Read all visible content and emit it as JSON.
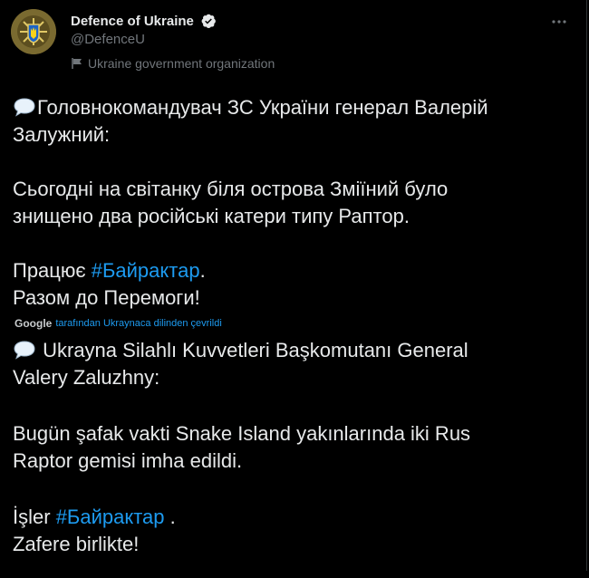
{
  "account": {
    "display_name": "Defence of Ukraine",
    "handle": "@DefenceU",
    "org_label": "Ukraine government organization"
  },
  "icons": {
    "verified": "verified-badge-icon",
    "more": "more-horizontal-icon",
    "flag": "flag-icon",
    "speech": "speech-balloon-emoji",
    "ukraine_flag": "ukraine-flag-emoji"
  },
  "colors": {
    "background": "#000000",
    "text": "#e7e9ea",
    "muted": "#71767b",
    "link": "#1d9bf0",
    "flag_blue": "#1a63c9",
    "flag_yellow": "#f7d21b"
  },
  "original": {
    "line1": "Головнокомандувач ЗС України генерал Валерій",
    "line2": "Залужний:",
    "line3": "Сьогодні на світанку біля острова Зміїний було",
    "line4": "знищено два російські катери типу Раптор.",
    "line5_prefix": "Працює ",
    "line5_hashtag": "#Байрактар",
    "line5_suffix": ".",
    "line6": "Разом до Перемоги!"
  },
  "translation_bar": {
    "google": "Google",
    "text": "tarafından Ukraynaca dilinden çevrildi"
  },
  "translated": {
    "line1": " Ukrayna Silahlı Kuvvetleri Başkomutanı General",
    "line2": "Valery Zaluzhny:",
    "line3": " Bugün şafak vakti Snake Island yakınlarında iki Rus",
    "line4": "Raptor gemisi imha edildi.",
    "line5_prefix": " İşler ",
    "line5_hashtag": "#Байрактар",
    "line5_suffix": " .",
    "line6": " Zafere birlikte! "
  }
}
